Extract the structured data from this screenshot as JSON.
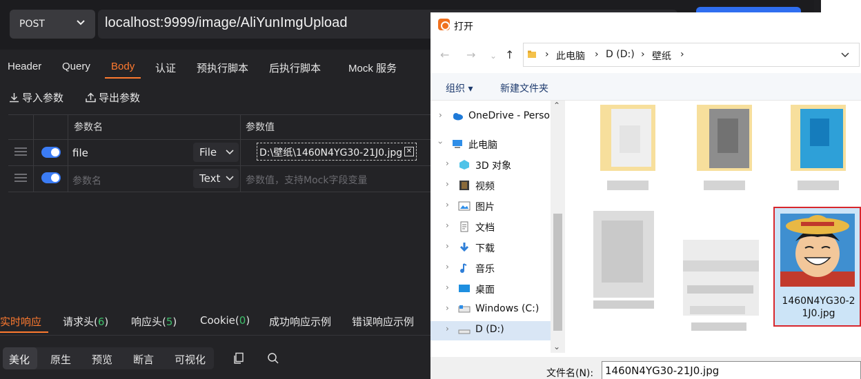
{
  "request": {
    "method": "POST",
    "url": "localhost:9999/image/AliYunImgUpload"
  },
  "tabs": [
    "Header",
    "Query",
    "Body",
    "认证",
    "预执行脚本",
    "后执行脚本",
    "Mock 服务"
  ],
  "actions": {
    "import": "导入参数",
    "export": "导出参数"
  },
  "params": {
    "col_name": "参数名",
    "col_value": "参数值",
    "rows": [
      {
        "name": "file",
        "type": "File",
        "value": "D:\\壁纸\\1460N4YG30-21J0.jpg",
        "enabled": true
      },
      {
        "name_placeholder": "参数名",
        "type": "Text",
        "value_placeholder": "参数值，支持Mock字段变量",
        "enabled": true
      }
    ]
  },
  "response": {
    "tabs": [
      "实时响应",
      "请求头(",
      "6",
      ")",
      "响应头(",
      "5",
      ")",
      "Cookie(",
      "0",
      ")",
      "成功响应示例",
      "错误响应示例"
    ],
    "view_modes": [
      "美化",
      "原生",
      "预览",
      "断言",
      "可视化"
    ]
  },
  "dialog": {
    "title": "打开",
    "breadcrumb": [
      "此电脑",
      "D (D:)",
      "壁纸"
    ],
    "toolbar": {
      "organize": "组织",
      "new_folder": "新建文件夹"
    },
    "tree": [
      {
        "label": "OneDrive - Perso",
        "icon": "cloud-icon",
        "level": 0
      },
      {
        "label": "此电脑",
        "icon": "computer-icon",
        "level": 0,
        "expanded": true
      },
      {
        "label": "3D 对象",
        "icon": "cube-icon",
        "level": 1
      },
      {
        "label": "视频",
        "icon": "video-icon",
        "level": 1
      },
      {
        "label": "图片",
        "icon": "picture-icon",
        "level": 1
      },
      {
        "label": "文档",
        "icon": "document-icon",
        "level": 1
      },
      {
        "label": "下载",
        "icon": "download-icon",
        "level": 1
      },
      {
        "label": "音乐",
        "icon": "music-icon",
        "level": 1
      },
      {
        "label": "桌面",
        "icon": "desktop-icon",
        "level": 1
      },
      {
        "label": "Windows  (C:)",
        "icon": "drive-icon",
        "level": 1
      },
      {
        "label": "D (D:)",
        "icon": "drive-icon",
        "level": 1,
        "selected": true
      }
    ],
    "selected_file": {
      "name_line1": "1460N4YG30-2",
      "name_line2": "1J0.jpg"
    },
    "filename_label": "文件名(N):",
    "filename_value": "1460N4YG30-21J0.jpg"
  },
  "colors": {
    "accent": "#ff7a2f",
    "toggle": "#3b7cf5",
    "count_green": "#3fbf6b",
    "selection_border": "#d8262c",
    "selection_fill": "#cce4f7"
  }
}
